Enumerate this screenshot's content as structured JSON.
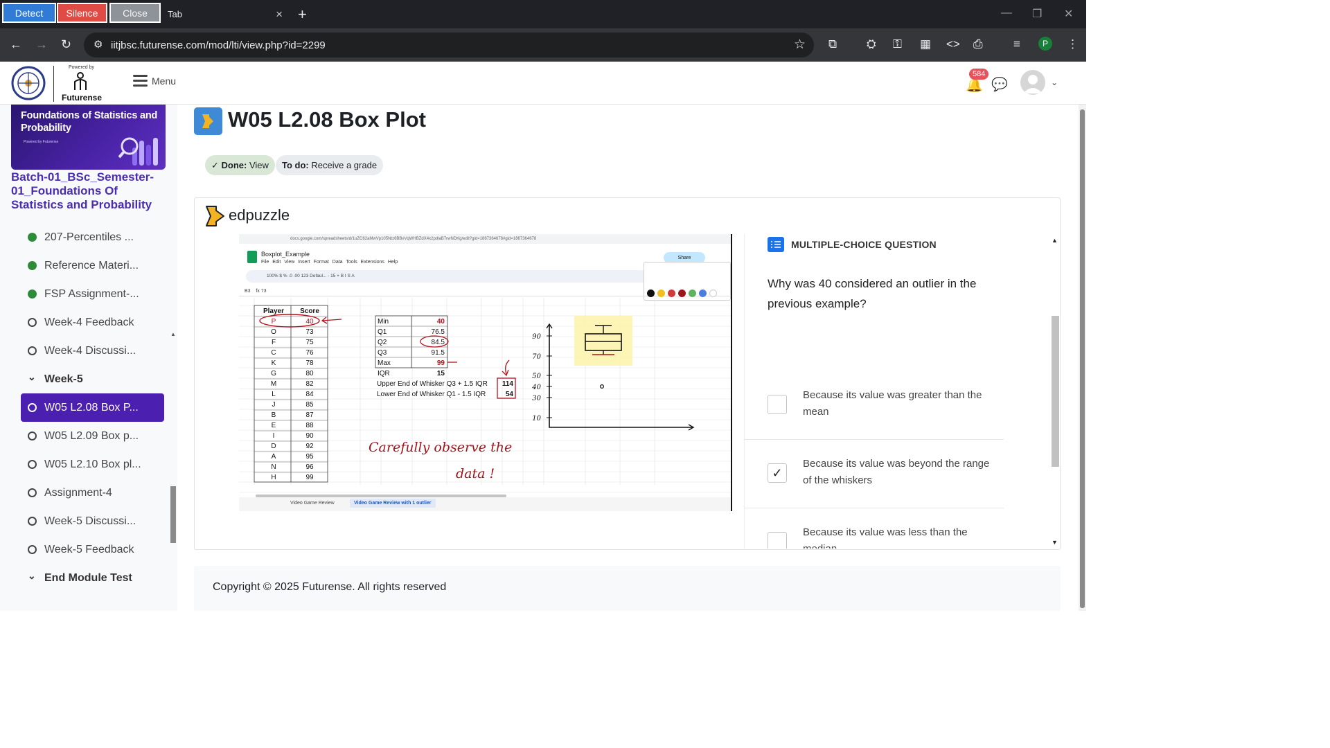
{
  "extension_bar": {
    "detect": "Detect",
    "silence": "Silence",
    "close": "Close"
  },
  "browser": {
    "tab_title": "Tab",
    "url": "iitjbsc.futurense.com/mod/lti/view.php?id=2299",
    "profile_initial": "P"
  },
  "site": {
    "powered_by": "Powered by",
    "brand": "Futurense",
    "menu_label": "Menu",
    "notification_count": "584"
  },
  "sidebar": {
    "banner_title": "Foundations of Statistics and Probability",
    "banner_powered": "Powered by Futurense",
    "course_title": "Batch-01_BSc_Semester-01_Foundations Of Statistics and Probability",
    "items": [
      {
        "label": "207-Percentiles ...",
        "state": "done"
      },
      {
        "label": "Reference Materi...",
        "state": "done"
      },
      {
        "label": "FSP Assignment-...",
        "state": "done"
      },
      {
        "label": "Week-4 Feedback",
        "state": "open"
      },
      {
        "label": "Week-4 Discussi...",
        "state": "open"
      },
      {
        "label": "Week-5",
        "state": "section"
      },
      {
        "label": "W05 L2.08 Box P...",
        "state": "active"
      },
      {
        "label": "W05 L2.09 Box p...",
        "state": "open"
      },
      {
        "label": "W05 L2.10 Box pl...",
        "state": "open"
      },
      {
        "label": "Assignment-4",
        "state": "open"
      },
      {
        "label": "Week-5 Discussi...",
        "state": "open"
      },
      {
        "label": "Week-5 Feedback",
        "state": "open"
      },
      {
        "label": "End Module Test",
        "state": "section"
      }
    ]
  },
  "page": {
    "title": "W05 L2.08 Box Plot",
    "done_label": "Done:",
    "done_value": "View",
    "todo_label": "To do:",
    "todo_value": "Receive a grade"
  },
  "edpuzzle": {
    "logo_text": "edpuzzle",
    "question_type": "MULTIPLE-CHOICE QUESTION",
    "question": "Why was 40 considered an outlier in the previous example?",
    "options": [
      {
        "text": "Because its value was greater than the mean",
        "checked": false
      },
      {
        "text": "Because its value was beyond the range of the whiskers",
        "checked": true
      },
      {
        "text": "Because its value was less than the median",
        "checked": false
      }
    ]
  },
  "video": {
    "sheet_url": "docs.google.com/spreadsheets/d/1uZC62aMwVp105Ntz6BBvVqWHBZdX4x2pdlaB7rwNDKg/edit?gid=1867364678#gid=1867364678",
    "doc_name": "Boxplot_Example",
    "menus": "File Edit View Insert Format Data Tools Extensions Help",
    "toolbar": "100%   $   %   .0   .00   123   Defaul...   -  15  +   B   I   S   A",
    "share": "Share",
    "cell_ref": "B3",
    "formula": "73",
    "headers": [
      "Player",
      "Score"
    ],
    "players": [
      "P",
      "O",
      "F",
      "C",
      "K",
      "G",
      "M",
      "L",
      "J",
      "B",
      "E",
      "I",
      "D",
      "A",
      "N",
      "H"
    ],
    "scores": [
      "40",
      "73",
      "75",
      "76",
      "78",
      "80",
      "82",
      "84",
      "85",
      "87",
      "88",
      "90",
      "92",
      "95",
      "96",
      "99"
    ],
    "stats": [
      {
        "k": "Min",
        "v": "40"
      },
      {
        "k": "Q1",
        "v": "76.5"
      },
      {
        "k": "Q2",
        "v": "84.5"
      },
      {
        "k": "Q3",
        "v": "91.5"
      },
      {
        "k": "Max",
        "v": "99"
      }
    ],
    "iqr_label": "IQR",
    "iqr_value": "15",
    "upper_label": "Upper End of Whisker Q3 + 1.5 IQR",
    "upper_value": "114",
    "lower_label": "Lower End of Whisker Q1 - 1.5 IQR",
    "lower_value": "54",
    "handwriting_1": "Carefully observe the",
    "handwriting_2": "data !",
    "axis_ticks": [
      "90",
      "70",
      "50",
      "40",
      "30",
      "10"
    ],
    "sheet_tab_1": "Video Game Review",
    "sheet_tab_2": "Video Game Review with 1 outlier"
  },
  "footer": {
    "copyright": "Copyright © 2025 Futurense. All rights reserved"
  },
  "colors": {
    "accent": "#4b1fb0",
    "done_green": "#2e8b3a",
    "ink_red": "#b3121c",
    "edpuzzle_blue": "#1a73e8"
  }
}
